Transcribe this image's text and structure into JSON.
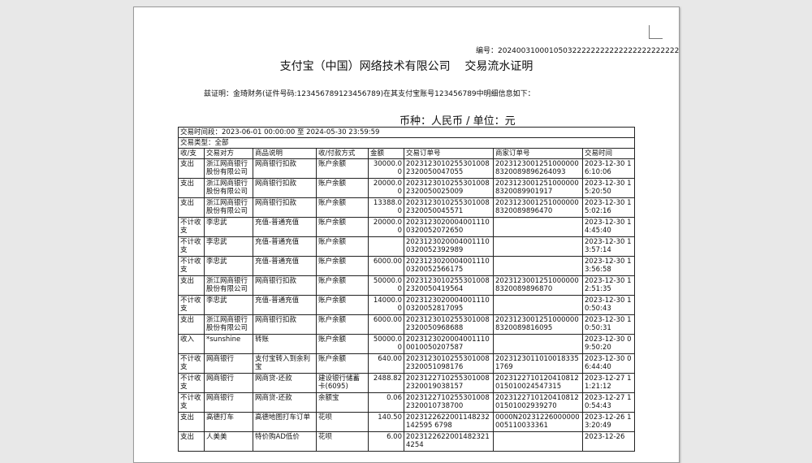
{
  "document": {
    "serial": "编号：2024003100010503222222222222222222222222",
    "title": "支付宝（中国）网络技术有限公司    交易流水证明",
    "statement": "兹证明：金琦财务(证件号码:123456789123456789)在其支付宝账号123456789中明细信息如下：",
    "currency_line": "币种：人民币 / 单位：元",
    "period": "交易时间段：2023-06-01 00:00:00 至 2024-05-30 23:59:59",
    "type": "交易类型：全部"
  },
  "table": {
    "headers": [
      "收/支",
      "交易对方",
      "商品说明",
      "收/付款方式",
      "金额",
      "交易订单号",
      "商家订单号",
      "交易时间"
    ],
    "rows": [
      [
        "支出",
        "浙江网商银行股份有限公司",
        "网商银行扣款",
        "账户余额",
        "30000.00",
        "20231230102553010082320050047055",
        "20231230012510000008320089896264093",
        "2023-12-30 16:10:06"
      ],
      [
        "支出",
        "浙江网商银行股份有限公司",
        "网商银行扣款",
        "账户余额",
        "20000.00",
        "20231230102553010082320050025009",
        "20231230012510000008320089901917",
        "2023-12-30 15:20:50"
      ],
      [
        "支出",
        "浙江网商银行股份有限公司",
        "网商银行扣款",
        "账户余额",
        "13388.00",
        "20231230102553010082320050045571",
        "20231230012510000008320089896470",
        "2023-12-30 15:02:16"
      ],
      [
        "不计收支",
        "李忠武",
        "充值-普通充值",
        "账户余额",
        "20000.00",
        "20231230200040011100320052072650",
        "",
        "2023-12-30 14:45:40"
      ],
      [
        "不计收支",
        "李忠武",
        "充值-普通充值",
        "账户余额",
        "",
        "20231230200040011100320052392989",
        "",
        "2023-12-30 13:57:14"
      ],
      [
        "不计收支",
        "李忠武",
        "充值-普通充值",
        "账户余额",
        "6000.00",
        "20231230200040011100320052566175",
        "",
        "2023-12-30 13:56:58"
      ],
      [
        "支出",
        "浙江网商银行股份有限公司",
        "网商银行扣款",
        "账户余额",
        "50000.00",
        "20231230102553010082320050419564",
        "20231230012510000008320089896870",
        "2023-12-30 12:51:35"
      ],
      [
        "不计收支",
        "李忠武",
        "充值-普通充值",
        "账户余额",
        "14000.00",
        "20231230200040011100320052817095",
        "",
        "2023-12-30 10:50:43"
      ],
      [
        "支出",
        "浙江网商银行股份有限公司",
        "网商银行扣款",
        "账户余额",
        "6000.00",
        "20231230102553010082320050968688",
        "20231230012510000008320089816095",
        "2023-12-30 10:50:31"
      ],
      [
        "收入",
        "*sunshine",
        "转账",
        "账户余额",
        "50000.00",
        "20231230200040011100010050207587",
        "",
        "2023-12-30 09:50:20"
      ],
      [
        "不计收支",
        "网商银行",
        "支付宝转入到余利宝",
        "账户余额",
        "640.00",
        "20231230102553010082320051098176",
        "20231230110100183351769",
        "2023-12-30 06:44:40"
      ],
      [
        "不计收支",
        "网商银行",
        "网商贷-还款",
        "建设银行储蓄卡(6095)",
        "2488.82",
        "20231227102553010082320019038157",
        "2023122710120410812015010024547315",
        "2023-12-27 11:21:12"
      ],
      [
        "不计收支",
        "网商银行",
        "网商贷-还款",
        "余额宝",
        "0.06",
        "20231227102553010082320010738700",
        "202312271012041081201501002939270",
        "2023-12-27 10:54:43"
      ],
      [
        "支出",
        "高德打车",
        "高德地图打车订单",
        "花呗",
        "140.50",
        "2023122622001148232142595 6798",
        "0000N20231226000000005110033361",
        "2023-12-26 13:20:49"
      ],
      [
        "支出",
        "人美美",
        "特价购AD低价",
        "花呗",
        "6.00",
        "20231226220014823214254",
        "",
        "2023-12-26"
      ]
    ]
  }
}
